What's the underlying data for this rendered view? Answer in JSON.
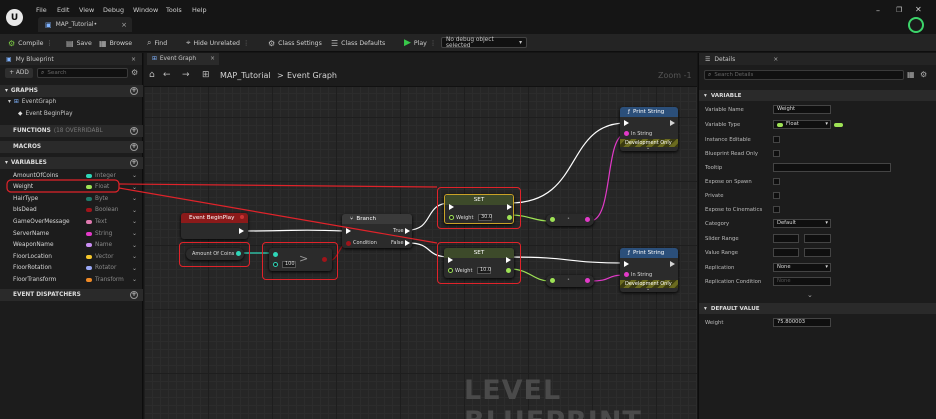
{
  "menu": {
    "items": [
      "File",
      "Edit",
      "View",
      "Debug",
      "Window",
      "Tools",
      "Help"
    ]
  },
  "doc_tab": "MAP_Tutorial•",
  "toolbar": {
    "compile": "Compile",
    "save": "Save",
    "browse": "Browse",
    "find": "Find",
    "hide_unrelated": "Hide Unrelated",
    "class_settings": "Class Settings",
    "class_defaults": "Class Defaults",
    "play": "Play",
    "debug_select": "No debug object selected"
  },
  "left": {
    "tab": "My Blueprint",
    "add": "+ ADD",
    "search_placeholder": "Search",
    "graphs": "GRAPHS",
    "event_graph": "EventGraph",
    "event_begin": "Event BeginPlay",
    "functions": "FUNCTIONS",
    "functions_suffix": "(18 OVERRIDABL",
    "macros": "MACROS",
    "variables": "VARIABLES",
    "dispatchers": "EVENT DISPATCHERS",
    "vars": [
      {
        "name": "AmountOfCoins",
        "type": "Integer",
        "color": "#2fd6b8"
      },
      {
        "name": "Weight",
        "type": "Float",
        "color": "#9ee255"
      },
      {
        "name": "HairType",
        "type": "Byte",
        "color": "#1f7a6a"
      },
      {
        "name": "bIsDead",
        "type": "Boolean",
        "color": "#a0141a"
      },
      {
        "name": "GameOverMessage",
        "type": "Text",
        "color": "#e07ab0"
      },
      {
        "name": "ServerName",
        "type": "String",
        "color": "#e23ac8"
      },
      {
        "name": "WeaponName",
        "type": "Name",
        "color": "#c98df2"
      },
      {
        "name": "FloorLocation",
        "type": "Vector",
        "color": "#f5c62b"
      },
      {
        "name": "FloorRotation",
        "type": "Rotator",
        "color": "#9aa8f5"
      },
      {
        "name": "FloorTransform",
        "type": "Transform",
        "color": "#f08a26"
      }
    ]
  },
  "graph": {
    "tab": "Event Graph",
    "breadcrumb_root": "MAP_Tutorial",
    "breadcrumb_sep": ">",
    "breadcrumb_leaf": "Event Graph",
    "zoom": "Zoom -1",
    "watermark": "LEVEL BLUEPRINT",
    "nodes": {
      "event": "Event BeginPlay",
      "amount": "Amount Of Coins",
      "compare_value": "100",
      "branch": "Branch",
      "condition": "Condition",
      "true": "True",
      "false": "False",
      "set1": "SET",
      "set1_pin": "Weight",
      "set1_val": "30.0",
      "set2": "SET",
      "set2_pin": "Weight",
      "set2_val": "10.0",
      "print1": "Print String",
      "print2": "Print String",
      "in_string": "In String",
      "dev_only": "Development Only"
    }
  },
  "details": {
    "tab": "Details",
    "search_placeholder": "Search Details",
    "variable_section": "VARIABLE",
    "props": {
      "variable_name": "Variable Name",
      "variable_name_val": "Weight",
      "variable_type": "Variable Type",
      "variable_type_val": "Float",
      "instance_editable": "Instance Editable",
      "bp_read_only": "Blueprint Read Only",
      "tooltip": "Tooltip",
      "expose_spawn": "Expose on Spawn",
      "private": "Private",
      "expose_cinematics": "Expose to Cinematics",
      "category": "Category",
      "category_val": "Default",
      "slider_range": "Slider Range",
      "value_range": "Value Range",
      "replication": "Replication",
      "replication_val": "None",
      "replication_condition": "Replication Condition",
      "replication_condition_val": "None"
    },
    "default_section": "DEFAULT VALUE",
    "weight": "Weight",
    "weight_val": "75.800003"
  },
  "colors": {
    "float": "#9ee255",
    "integer": "#2fd6b8",
    "highlight": "#e0232a",
    "event_header": "#8b1a1a",
    "set_header": "#3d4a2a",
    "print_header": "#2b4f7a"
  }
}
